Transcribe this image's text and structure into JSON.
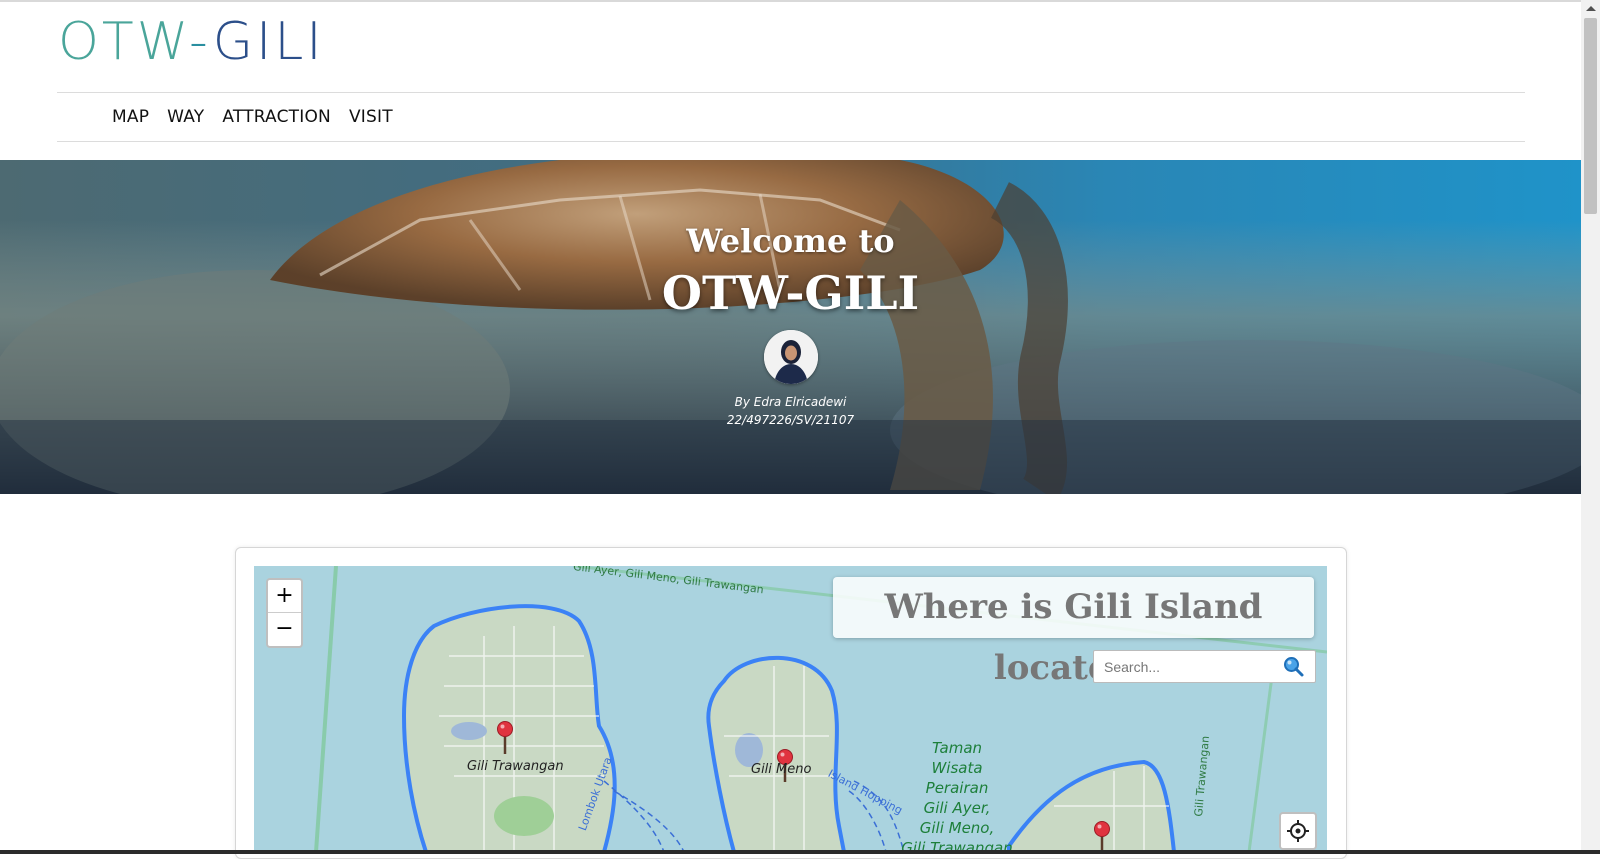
{
  "logo": {
    "part1": "OTW",
    "dash": "-",
    "part2": "GILI"
  },
  "nav": {
    "items": [
      "MAP",
      "WAY",
      "ATTRACTION",
      "VISIT"
    ]
  },
  "hero": {
    "welcome": "Welcome to",
    "title": "OTW-GILI",
    "author": "By Edra Elricadewi",
    "student_id": "22/497226/SV/21107"
  },
  "map": {
    "title": "Where is Gili Island located?",
    "zoom_in": "+",
    "zoom_out": "−",
    "search_placeholder": "Search...",
    "labels": {
      "gili_trawangan": "Gili Trawangan",
      "gili_meno": "Gili Meno",
      "park_line1": "Taman",
      "park_line2": "Wisata",
      "park_line3": "Perairan",
      "park_line4": "Gili Ayer,",
      "park_line5": "Gili Meno,",
      "park_line6": "Gili Trawangan",
      "top_road": "Gili Ayer, Gili Meno, Gili Trawangan",
      "right_road": "Gili Trawangan",
      "island_hopping": "Island Hopping",
      "lombok_utara": "Lombok Utara"
    },
    "icons": {
      "search": "search-icon",
      "locate": "locate-icon",
      "marker": "map-marker-icon"
    }
  },
  "colors": {
    "logo_teal": "#4aa59a",
    "logo_blue": "#2c4f8a",
    "sea": "#aad3df",
    "island_border": "#3b82f6",
    "marker_red": "#d7263d"
  }
}
